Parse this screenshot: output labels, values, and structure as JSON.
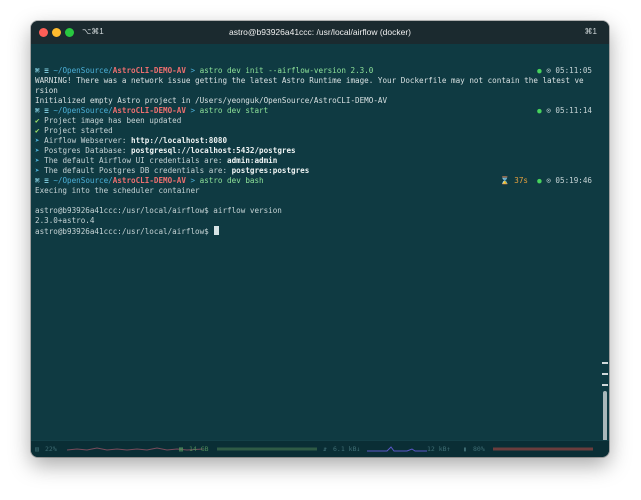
{
  "window": {
    "title": "astro@b93926a41ccc: /usr/local/airflow (docker)",
    "tab_shortcut": "⌥⌘1",
    "right_shortcut": "⌘1"
  },
  "terminal": {
    "lines": [
      {
        "segments": [
          {
            "t": "⌘ ",
            "c": "prompt-mark"
          },
          {
            "t": "≡ ",
            "c": "prompt-mark"
          },
          {
            "t": "~/OpenSource/",
            "c": "path-blue"
          },
          {
            "t": "AstroCLI-DEMO-AV",
            "c": "dir-bold"
          },
          {
            "t": " > ",
            "c": "path-blue"
          },
          {
            "t": "astro dev init --airflow-version 2.3.0",
            "c": "cmd"
          }
        ],
        "status": [
          {
            "t": "● ",
            "c": "dot-green"
          },
          {
            "t": "⊙ 05:11:05",
            "c": ""
          }
        ]
      },
      {
        "segments": [
          {
            "t": "WARNING! There was a network issue getting the latest Astro Runtime image. Your Dockerfile may not contain the latest ve",
            "c": "warn"
          }
        ]
      },
      {
        "segments": [
          {
            "t": "rsion",
            "c": "warn"
          }
        ]
      },
      {
        "segments": [
          {
            "t": "Initialized empty Astro project in /Users/yeonguk/OpenSource/AstroCLI-DEMO-AV",
            "c": "warn"
          }
        ]
      },
      {
        "segments": [
          {
            "t": "⌘ ",
            "c": "prompt-mark"
          },
          {
            "t": "≡ ",
            "c": "prompt-mark"
          },
          {
            "t": "~/OpenSource/",
            "c": "path-blue"
          },
          {
            "t": "AstroCLI-DEMO-AV",
            "c": "dir-bold"
          },
          {
            "t": " > ",
            "c": "path-blue"
          },
          {
            "t": "astro dev start",
            "c": "cmd"
          }
        ],
        "status": [
          {
            "t": "● ",
            "c": "dot-green"
          },
          {
            "t": "⊙ 05:11:14",
            "c": ""
          }
        ]
      },
      {
        "segments": [
          {
            "t": "✔ ",
            "c": "check"
          },
          {
            "t": "Project image has been updated",
            "c": ""
          }
        ]
      },
      {
        "segments": [
          {
            "t": "✔ ",
            "c": "check"
          },
          {
            "t": "Project started",
            "c": ""
          }
        ]
      },
      {
        "segments": [
          {
            "t": "➤ ",
            "c": "arrow"
          },
          {
            "t": "Airflow Webserver: ",
            "c": ""
          },
          {
            "t": "http://localhost:8080",
            "c": "bold"
          }
        ]
      },
      {
        "segments": [
          {
            "t": "➤ ",
            "c": "arrow"
          },
          {
            "t": "Postgres Database: ",
            "c": ""
          },
          {
            "t": "postgresql://localhost:5432/postgres",
            "c": "bold"
          }
        ]
      },
      {
        "segments": [
          {
            "t": "➤ ",
            "c": "arrow"
          },
          {
            "t": "The default Airflow UI credentials are: ",
            "c": ""
          },
          {
            "t": "admin:admin",
            "c": "bold"
          }
        ]
      },
      {
        "segments": [
          {
            "t": "➤ ",
            "c": "arrow"
          },
          {
            "t": "The default Postgres DB credentials are: ",
            "c": ""
          },
          {
            "t": "postgres:postgres",
            "c": "bold"
          }
        ]
      },
      {
        "segments": [
          {
            "t": "⌘ ",
            "c": "prompt-mark"
          },
          {
            "t": "≡ ",
            "c": "prompt-mark"
          },
          {
            "t": "~/OpenSource/",
            "c": "path-blue"
          },
          {
            "t": "AstroCLI-DEMO-AV",
            "c": "dir-bold"
          },
          {
            "t": " > ",
            "c": "path-blue"
          },
          {
            "t": "astro dev bash",
            "c": "cmd"
          }
        ],
        "status": [
          {
            "t": "⌛ ",
            "c": "hourglass"
          },
          {
            "t": "37s",
            "c": "secs"
          },
          {
            "t": "  ● ",
            "c": "dot-green"
          },
          {
            "t": "⊙ 05:19:46",
            "c": ""
          }
        ]
      },
      {
        "segments": [
          {
            "t": "Execing into the scheduler container",
            "c": ""
          }
        ]
      },
      {
        "segments": []
      },
      {
        "segments": [
          {
            "t": "astro@b93926a41ccc:/usr/local/airflow$ airflow version",
            "c": ""
          }
        ]
      },
      {
        "segments": [
          {
            "t": "2.3.0+astro.4",
            "c": ""
          }
        ]
      },
      {
        "segments": [
          {
            "t": "astro@b93926a41ccc:/usr/local/airflow$ ",
            "c": ""
          }
        ],
        "cursor": true
      }
    ]
  },
  "statusbar": {
    "cpu": "22%",
    "memory": "14 GB",
    "net_down": "6.1 kB↓",
    "net_up": "12 kB↑",
    "battery": "80%"
  }
}
